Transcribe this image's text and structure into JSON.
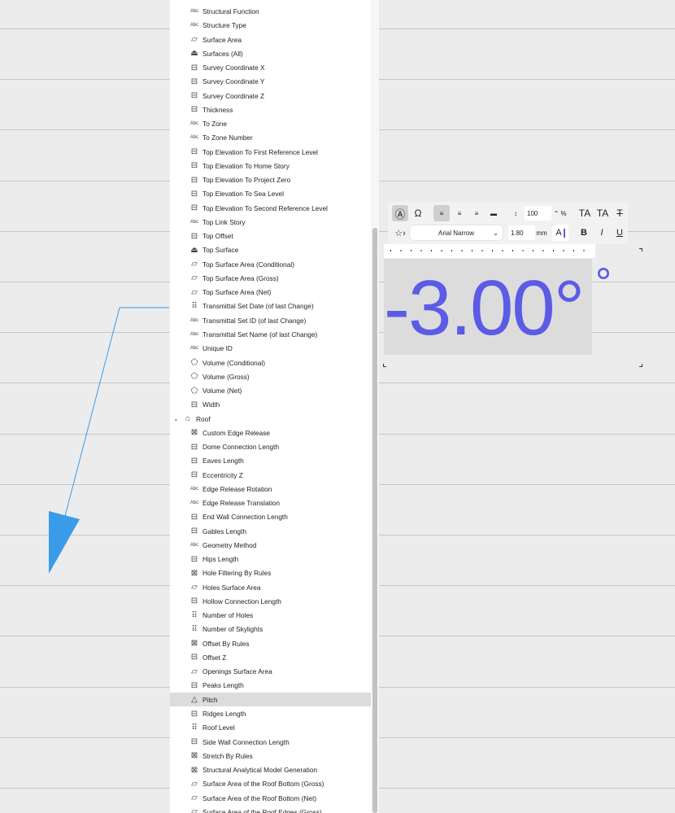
{
  "colors": {
    "accent": "#5b5be6",
    "arrow": "#3a9be8",
    "selected": "#dcdcdc"
  },
  "list": [
    {
      "label": "Structural Function",
      "icon": "abc"
    },
    {
      "label": "Structure Type",
      "icon": "abc"
    },
    {
      "label": "Surface Area",
      "icon": "area"
    },
    {
      "label": "Surfaces (All)",
      "icon": "surfaces"
    },
    {
      "label": "Survey Coordinate X",
      "icon": "dimension"
    },
    {
      "label": "Survey Coordinate Y",
      "icon": "dimension"
    },
    {
      "label": "Survey Coordinate Z",
      "icon": "dimension"
    },
    {
      "label": "Thickness",
      "icon": "dimension"
    },
    {
      "label": "To Zone",
      "icon": "abc"
    },
    {
      "label": "To Zone Number",
      "icon": "abc"
    },
    {
      "label": "Top Elevation To First Reference Level",
      "icon": "dimension"
    },
    {
      "label": "Top Elevation To Home Story",
      "icon": "dimension"
    },
    {
      "label": "Top Elevation To Project Zero",
      "icon": "dimension"
    },
    {
      "label": "Top Elevation To Sea Level",
      "icon": "dimension"
    },
    {
      "label": "Top Elevation To Second Reference Level",
      "icon": "dimension"
    },
    {
      "label": "Top Link Story",
      "icon": "abc"
    },
    {
      "label": "Top Offset",
      "icon": "dimension"
    },
    {
      "label": "Top Surface",
      "icon": "surfaces"
    },
    {
      "label": "Top Surface Area (Conditional)",
      "icon": "area"
    },
    {
      "label": "Top Surface Area (Gross)",
      "icon": "area"
    },
    {
      "label": "Top Surface Area (Net)",
      "icon": "area"
    },
    {
      "label": "Transmittal Set Date (of last Change)",
      "icon": "count"
    },
    {
      "label": "Transmittal Set ID (of last Change)",
      "icon": "abc"
    },
    {
      "label": "Transmittal Set Name (of last Change)",
      "icon": "abc"
    },
    {
      "label": "Unique ID",
      "icon": "abc"
    },
    {
      "label": "Volume (Conditional)",
      "icon": "volume"
    },
    {
      "label": "Volume (Gross)",
      "icon": "volume"
    },
    {
      "label": "Volume (Net)",
      "icon": "volume"
    },
    {
      "label": "Width",
      "icon": "dimension"
    },
    {
      "label": "Roof",
      "icon": "roof",
      "group": true
    },
    {
      "label": "Custom Edge Release",
      "icon": "checkbox"
    },
    {
      "label": "Dome Connection Length",
      "icon": "dimension"
    },
    {
      "label": "Eaves Length",
      "icon": "dimension"
    },
    {
      "label": "Eccentricity Z",
      "icon": "dimension"
    },
    {
      "label": "Edge Release Rotation",
      "icon": "abc"
    },
    {
      "label": "Edge Release Translation",
      "icon": "abc"
    },
    {
      "label": "End Wall Connection Length",
      "icon": "dimension"
    },
    {
      "label": "Gables Length",
      "icon": "dimension"
    },
    {
      "label": "Geometry Method",
      "icon": "abc"
    },
    {
      "label": "Hips Length",
      "icon": "dimension"
    },
    {
      "label": "Hole Filtering By Rules",
      "icon": "checkbox"
    },
    {
      "label": "Holes Surface Area",
      "icon": "area"
    },
    {
      "label": "Hollow Connection Length",
      "icon": "dimension"
    },
    {
      "label": "Number of Holes",
      "icon": "count"
    },
    {
      "label": "Number of Skylights",
      "icon": "count"
    },
    {
      "label": "Offset By Rules",
      "icon": "checkbox"
    },
    {
      "label": "Offset Z",
      "icon": "dimension"
    },
    {
      "label": "Openings Surface Area",
      "icon": "area"
    },
    {
      "label": "Peaks Length",
      "icon": "dimension"
    },
    {
      "label": "Pitch",
      "icon": "angle",
      "selected": true
    },
    {
      "label": "Ridges Length",
      "icon": "dimension"
    },
    {
      "label": "Roof Level",
      "icon": "count"
    },
    {
      "label": "Side Wall Connection Length",
      "icon": "dimension"
    },
    {
      "label": "Stretch By Rules",
      "icon": "checkbox"
    },
    {
      "label": "Structural Analytical Model Generation",
      "icon": "checkbox"
    },
    {
      "label": "Surface Area of the Roof Bottom (Gross)",
      "icon": "area"
    },
    {
      "label": "Surface Area of the Roof Bottom (Net)",
      "icon": "area"
    },
    {
      "label": "Surface Area of the Roof Edges (Gross)",
      "icon": "area"
    }
  ],
  "toolbar": {
    "line_spacing": "100",
    "percent": "%",
    "font": "Arial Narrow",
    "size": "1.80",
    "unit": "mm",
    "superscript": "TA",
    "subscript": "TA",
    "strike": "T",
    "bold": "B",
    "italic": "I",
    "underline": "U",
    "color_label": "A"
  },
  "label_text": "-3.00°",
  "label_text_behind": "°"
}
